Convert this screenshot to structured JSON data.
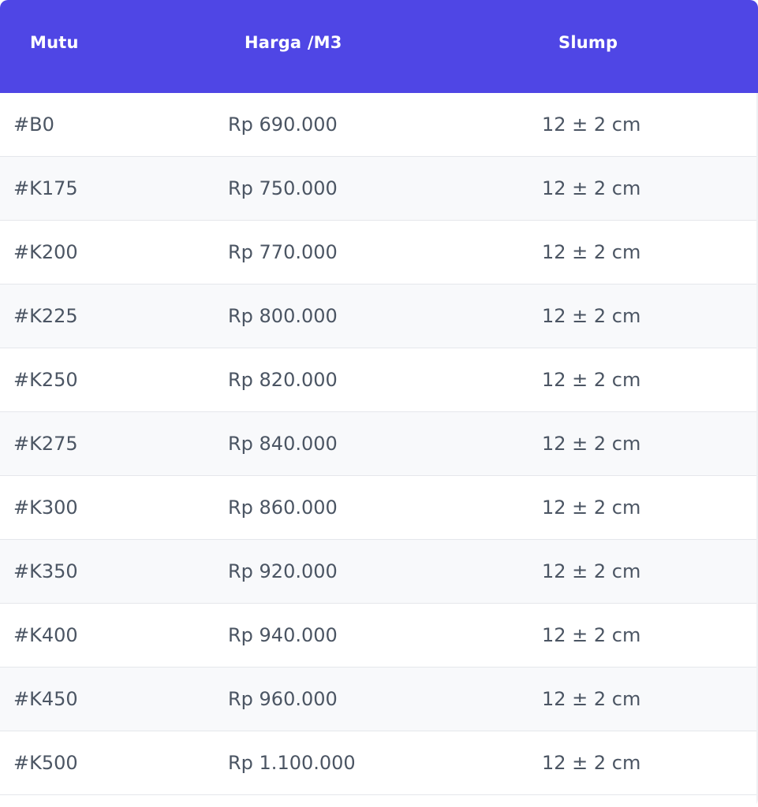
{
  "table": {
    "headers": [
      "Mutu",
      "Harga /M3",
      "Slump"
    ],
    "rows": [
      {
        "mutu": "#B0",
        "harga": "Rp 690.000",
        "slump": "12 ± 2 cm"
      },
      {
        "mutu": "#K175",
        "harga": "Rp 750.000",
        "slump": "12 ± 2 cm"
      },
      {
        "mutu": "#K200",
        "harga": "Rp 770.000",
        "slump": "12 ± 2 cm"
      },
      {
        "mutu": "#K225",
        "harga": "Rp 800.000",
        "slump": "12 ± 2 cm"
      },
      {
        "mutu": "#K250",
        "harga": "Rp 820.000",
        "slump": "12 ± 2 cm"
      },
      {
        "mutu": "#K275",
        "harga": "Rp 840.000",
        "slump": "12 ± 2 cm"
      },
      {
        "mutu": "#K300",
        "harga": "Rp 860.000",
        "slump": "12 ± 2 cm"
      },
      {
        "mutu": "#K350",
        "harga": "Rp 920.000",
        "slump": "12 ± 2 cm"
      },
      {
        "mutu": "#K400",
        "harga": "Rp 940.000",
        "slump": "12 ± 2 cm"
      },
      {
        "mutu": "#K450",
        "harga": "Rp 960.000",
        "slump": "12 ± 2 cm"
      },
      {
        "mutu": "#K500",
        "harga": "Rp 1.100.000",
        "slump": "12 ± 2 cm"
      }
    ]
  },
  "colors": {
    "header_bg": "#4f46e5",
    "header_text": "#ffffff",
    "row_text": "#4b5563",
    "row_alt_bg": "#f8f9fb",
    "border": "#e5e7eb"
  }
}
